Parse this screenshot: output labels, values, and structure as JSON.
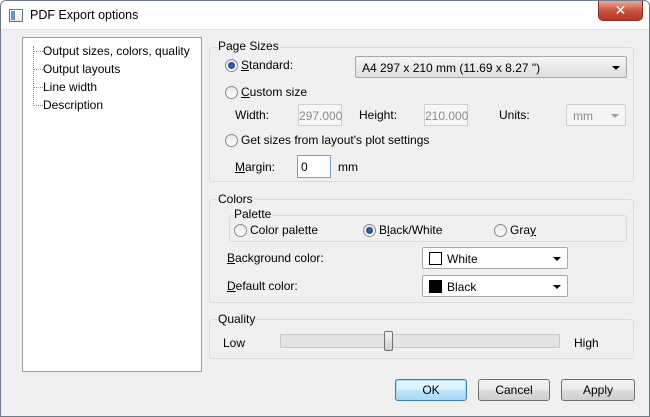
{
  "window": {
    "title": "PDF Export options",
    "close_glyph": "✕"
  },
  "tree": {
    "items": [
      {
        "label": "Output sizes, colors, quality"
      },
      {
        "label": "Output layouts"
      },
      {
        "label": "Line width"
      },
      {
        "label": "Description"
      }
    ]
  },
  "page_sizes": {
    "group_label": "Page Sizes",
    "standard": {
      "accel": "S",
      "rest": "tandard:",
      "selected": true,
      "value": "A4 297 x 210 mm (11.69 x 8.27 \")"
    },
    "custom": {
      "accel": "C",
      "rest": "ustom size",
      "selected": false
    },
    "width_label": "Width:",
    "width_value": "297.000",
    "height_label": "Height:",
    "height_value": "210.000",
    "units_label": "Units:",
    "units_value": "mm",
    "from_layout": {
      "label": "Get sizes from layout's plot settings",
      "selected": false
    },
    "margin": {
      "accel": "M",
      "rest": "argin:",
      "value": "0",
      "unit": "mm"
    }
  },
  "colors": {
    "group_label": "Colors",
    "palette_label": "Palette",
    "options": {
      "color": {
        "label": "Color palette",
        "selected": false
      },
      "bw": {
        "pre": "B",
        "accel": "l",
        "rest": "ack/White",
        "selected": true
      },
      "gray": {
        "pre": "Gra",
        "accel": "y",
        "rest": "",
        "selected": false
      }
    },
    "background": {
      "accel": "B",
      "rest": "ackground color:",
      "value": "White",
      "swatch": "#ffffff"
    },
    "default": {
      "accel": "D",
      "rest": "efault color:",
      "value": "Black",
      "swatch": "#000000"
    }
  },
  "quality": {
    "group_label": "Quality",
    "low_label": "Low",
    "high_label": "High",
    "level": 0.4
  },
  "buttons": {
    "ok": "OK",
    "cancel": "Cancel",
    "apply": "Apply"
  }
}
